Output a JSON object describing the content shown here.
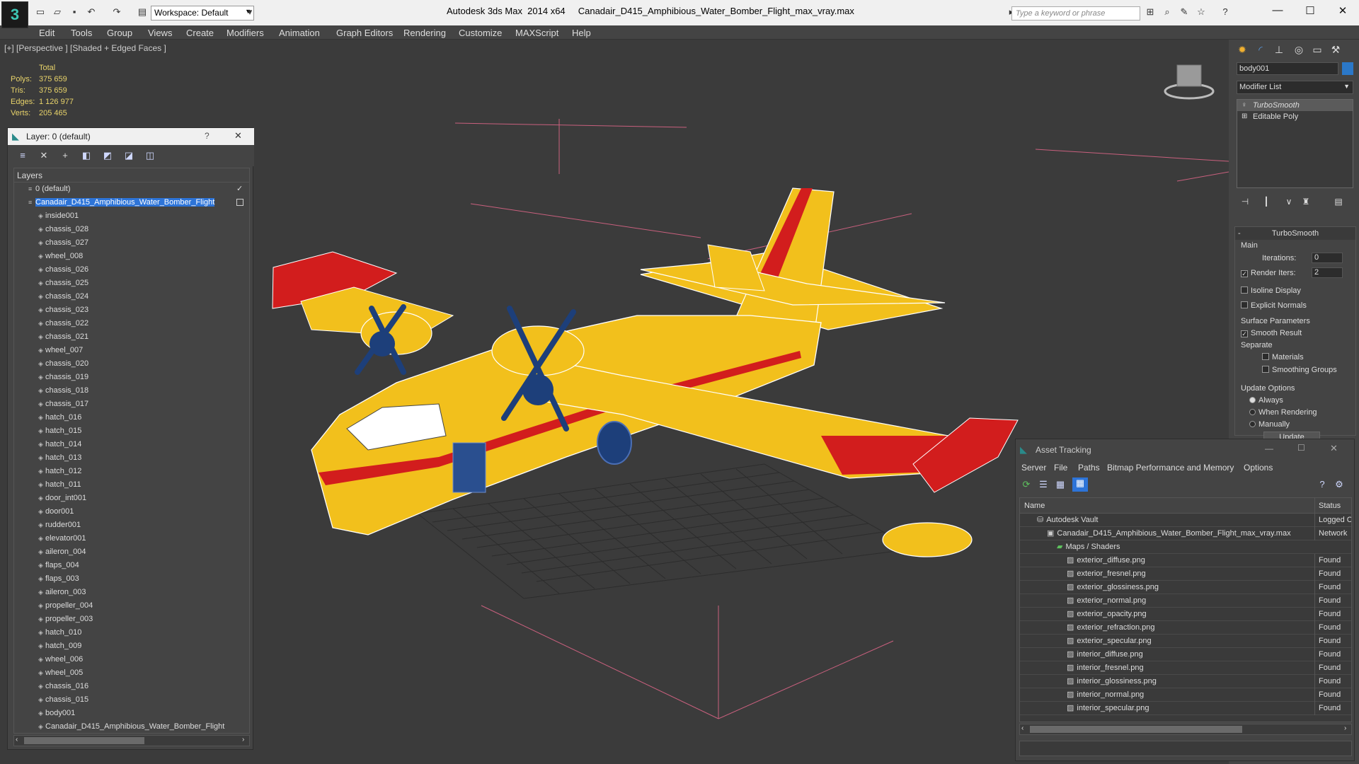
{
  "app": {
    "title": "Autodesk 3ds Max  2014 x64     Canadair_D415_Amphibious_Water_Bomber_Flight_max_vray.max",
    "logo": "3",
    "workspace": "Workspace: Default",
    "search_placeholder": "Type a keyword or phrase"
  },
  "menu": [
    "Edit",
    "Tools",
    "Group",
    "Views",
    "Create",
    "Modifiers",
    "Animation",
    "Graph Editors",
    "Rendering",
    "Customize",
    "MAXScript",
    "Help"
  ],
  "viewport": {
    "label": "[+] [Perspective ] [Shaded + Edged Faces ]",
    "stats": {
      "header": "Total",
      "rows": [
        {
          "label": "Polys:",
          "value": "375 659"
        },
        {
          "label": "Tris:",
          "value": "375 659"
        },
        {
          "label": "Edges:",
          "value": "1 126 977"
        },
        {
          "label": "Verts:",
          "value": "205 465"
        }
      ]
    }
  },
  "layer_window": {
    "title": "Layer: 0 (default)",
    "help": "?",
    "close": "✕",
    "list_header": "Layers",
    "default_layer": "0 (default)",
    "selected_layer": "Canadair_D415_Amphibious_Water_Bomber_Flight",
    "objects": [
      "inside001",
      "chassis_028",
      "chassis_027",
      "wheel_008",
      "chassis_026",
      "chassis_025",
      "chassis_024",
      "chassis_023",
      "chassis_022",
      "chassis_021",
      "wheel_007",
      "chassis_020",
      "chassis_019",
      "chassis_018",
      "chassis_017",
      "hatch_016",
      "hatch_015",
      "hatch_014",
      "hatch_013",
      "hatch_012",
      "hatch_011",
      "door_int001",
      "door001",
      "rudder001",
      "elevator001",
      "aileron_004",
      "flaps_004",
      "flaps_003",
      "aileron_003",
      "propeller_004",
      "propeller_003",
      "hatch_010",
      "hatch_009",
      "wheel_006",
      "wheel_005",
      "chassis_016",
      "chassis_015",
      "body001",
      "Canadair_D415_Amphibious_Water_Bomber_Flight"
    ]
  },
  "command_panel": {
    "object_name": "body001",
    "object_color": "#2b78c8",
    "modifier_list": "Modifier List",
    "stack": [
      "TurboSmooth",
      "Editable Poly"
    ],
    "rollout_title": "TurboSmooth",
    "main_label": "Main",
    "iterations_label": "Iterations:",
    "iterations_value": "0",
    "render_iters_label": "Render Iters:",
    "render_iters_value": "2",
    "isoline": "Isoline Display",
    "explicit_normals": "Explicit Normals",
    "surface_params": "Surface Parameters",
    "smooth_result": "Smooth Result",
    "separate": "Separate",
    "materials": "Materials",
    "smoothing_groups": "Smoothing Groups",
    "update_options": "Update Options",
    "always": "Always",
    "when_rendering": "When Rendering",
    "manually": "Manually",
    "update_btn": "Update"
  },
  "asset_window": {
    "title": "Asset Tracking",
    "menu": [
      "Server",
      "File",
      "Paths",
      "Bitmap Performance and Memory",
      "Options"
    ],
    "col_name": "Name",
    "col_status": "Status",
    "rows": [
      {
        "name": "Autodesk Vault",
        "status": "Logged C",
        "indent": 0
      },
      {
        "name": "Canadair_D415_Amphibious_Water_Bomber_Flight_max_vray.max",
        "status": "Network",
        "indent": 1
      },
      {
        "name": "Maps / Shaders",
        "status": "",
        "indent": 2
      },
      {
        "name": "exterior_diffuse.png",
        "status": "Found",
        "indent": 3
      },
      {
        "name": "exterior_fresnel.png",
        "status": "Found",
        "indent": 3
      },
      {
        "name": "exterior_glossiness.png",
        "status": "Found",
        "indent": 3
      },
      {
        "name": "exterior_normal.png",
        "status": "Found",
        "indent": 3
      },
      {
        "name": "exterior_opacity.png",
        "status": "Found",
        "indent": 3
      },
      {
        "name": "exterior_refraction.png",
        "status": "Found",
        "indent": 3
      },
      {
        "name": "exterior_specular.png",
        "status": "Found",
        "indent": 3
      },
      {
        "name": "interior_diffuse.png",
        "status": "Found",
        "indent": 3
      },
      {
        "name": "interior_fresnel.png",
        "status": "Found",
        "indent": 3
      },
      {
        "name": "interior_glossiness.png",
        "status": "Found",
        "indent": 3
      },
      {
        "name": "interior_normal.png",
        "status": "Found",
        "indent": 3
      },
      {
        "name": "interior_specular.png",
        "status": "Found",
        "indent": 3
      }
    ]
  },
  "colors": {
    "accent": "#2d74d8",
    "stats": "#e8d36a",
    "plane_yellow": "#f2c01c",
    "plane_red": "#d21d1d",
    "prop_blue": "#1d3f7a"
  }
}
